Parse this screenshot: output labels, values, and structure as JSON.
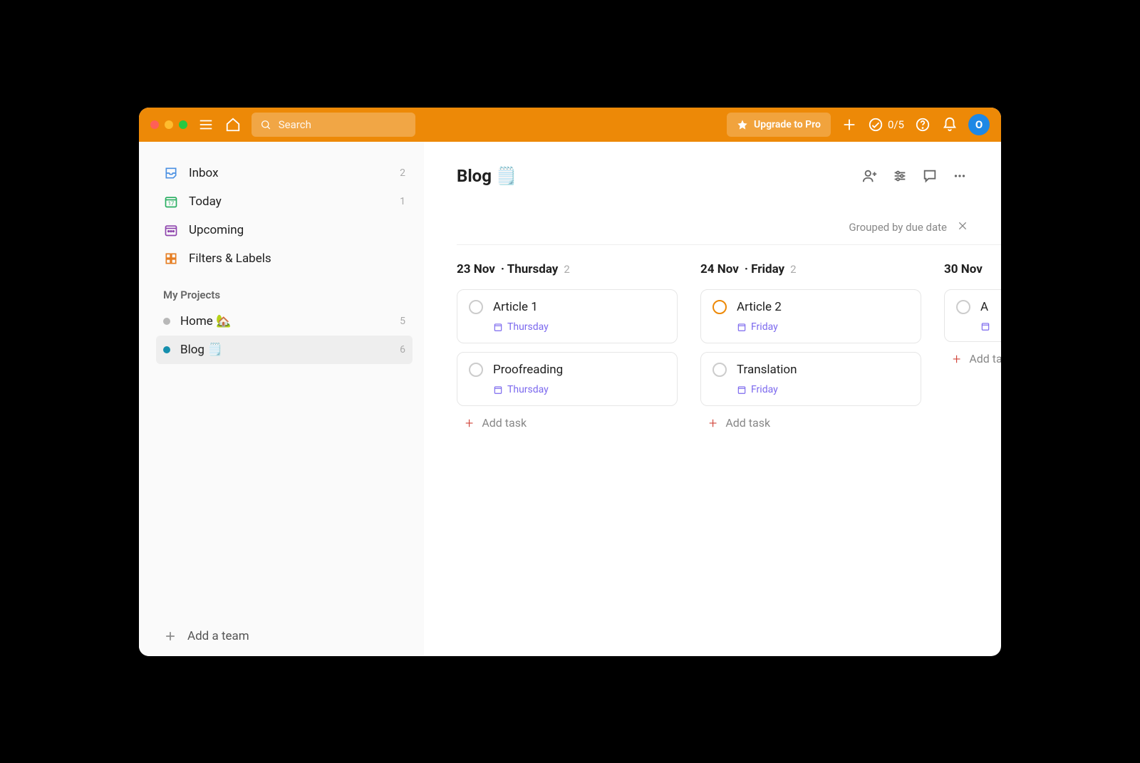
{
  "toolbar": {
    "search_placeholder": "Search",
    "upgrade_label": "Upgrade to Pro",
    "counter": "0/5",
    "avatar_initial": "O"
  },
  "sidebar": {
    "items": [
      {
        "label": "Inbox",
        "count": "2"
      },
      {
        "label": "Today",
        "count": "1"
      },
      {
        "label": "Upcoming",
        "count": ""
      },
      {
        "label": "Filters & Labels",
        "count": ""
      }
    ],
    "projects_title": "My Projects",
    "projects": [
      {
        "label": "Home 🏡",
        "count": "5",
        "color": "#b8b8b8"
      },
      {
        "label": "Blog 🗒️",
        "count": "6",
        "color": "#158FAD"
      }
    ],
    "add_team_label": "Add a team"
  },
  "main": {
    "title": "Blog 🗒️",
    "group_label": "Grouped by due date",
    "columns": [
      {
        "date": "23 Nov",
        "day": "Thursday",
        "count": "2",
        "tasks": [
          {
            "title": "Article 1",
            "due": "Thursday",
            "priority": "default"
          },
          {
            "title": "Proofreading",
            "due": "Thursday",
            "priority": "default"
          }
        ]
      },
      {
        "date": "24 Nov",
        "day": "Friday",
        "count": "2",
        "tasks": [
          {
            "title": "Article 2",
            "due": "Friday",
            "priority": "orange"
          },
          {
            "title": "Translation",
            "due": "Friday",
            "priority": "default"
          }
        ]
      },
      {
        "date": "30 Nov",
        "day": "",
        "count": "",
        "tasks": [
          {
            "title": "A",
            "due": "",
            "priority": "default"
          }
        ]
      }
    ],
    "add_task_label": "Add task"
  }
}
